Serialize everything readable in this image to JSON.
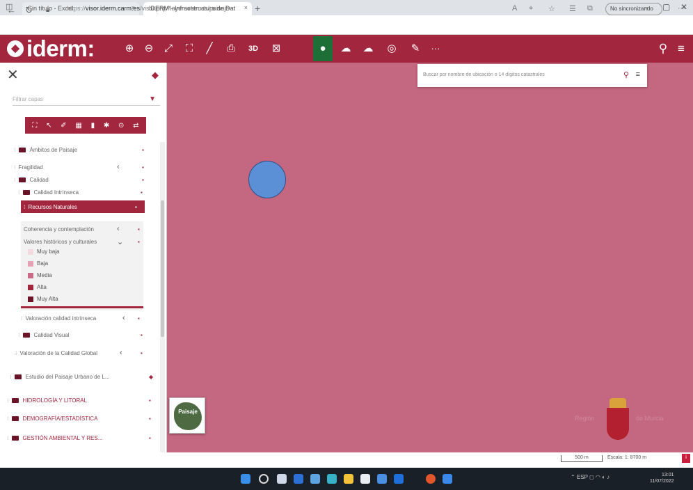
{
  "browser": {
    "tab_inactive": "Sin título - Excel",
    "tab_active": "IDERM - Infraestructura de Dat",
    "new_tab": "+",
    "url_host": "visor.iderm.carm.es",
    "url_rest": "/visor.php?layers=temas/paisaje",
    "incognito_label": "No sincronizando"
  },
  "app": {
    "logo_text": "iderm:",
    "toolbar_3d": "3D",
    "more": "···"
  },
  "search": {
    "placeholder": "Buscar por nombre de ubicación o 14 dígitos catastrales"
  },
  "sidebar": {
    "filter_placeholder": "Filtrar capas",
    "items": [
      {
        "label": "Ámbitos de Paisaje"
      },
      {
        "label": "Fragilidad"
      },
      {
        "label": "Calidad"
      },
      {
        "label": "Calidad Intrínseca"
      },
      {
        "label": "Recursos Naturales"
      },
      {
        "label": "Coherencia y contemplación"
      },
      {
        "label": "Valores históricos y culturales"
      },
      {
        "label": "Valoración calidad intrínseca"
      },
      {
        "label": "Calidad Visual"
      },
      {
        "label": "Valoración de la Calidad Global"
      },
      {
        "label": "Estudio del Paisaje Urbano de L..."
      },
      {
        "label": "HIDROLOGÍA Y LITORAL"
      },
      {
        "label": "DEMOGRAFÍA/ESTADÍSTICA"
      },
      {
        "label": "GESTIÓN AMBIENTAL Y RES..."
      }
    ],
    "legend": [
      {
        "label": "Muy baja",
        "color": "#f3d9e0"
      },
      {
        "label": "Baja",
        "color": "#e3a3b4"
      },
      {
        "label": "Media",
        "color": "#c96a86"
      },
      {
        "label": "Alta",
        "color": "#a3263f"
      },
      {
        "label": "Muy Alta",
        "color": "#6b1327"
      }
    ]
  },
  "map": {
    "thumb_label": "Paisaje",
    "crest_left": "Región",
    "crest_right": "de Murcia"
  },
  "status": {
    "scale": "500 m",
    "text": "Escala: 1: 8700 m"
  },
  "taskbar": {
    "tray": "ESP",
    "time": "13:01",
    "date": "11/07/2022"
  },
  "colors": {
    "brand": "#a3263f",
    "map": "#c46780",
    "active_tool": "#1e6e38",
    "marker": "#5b8fd6"
  }
}
